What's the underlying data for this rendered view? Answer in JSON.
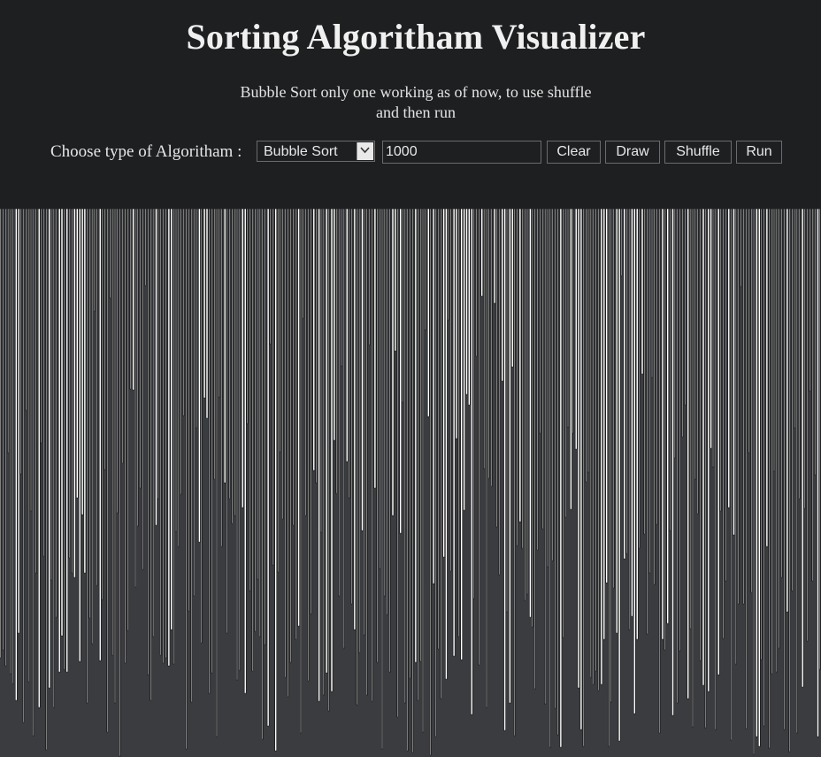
{
  "page": {
    "title": "Sorting Algoritham Visualizer",
    "note": "Bubble Sort only one working as of now, to use shuffle and then run"
  },
  "controls": {
    "algorithm_label": "Choose type of Algoritham :",
    "algorithm_select": {
      "selected": "Bubble Sort",
      "arrow_icon": "chevron-down-icon"
    },
    "count_input": {
      "value": "1000"
    },
    "buttons": {
      "clear": "Clear",
      "draw": "Draw",
      "shuffle": "Shuffle",
      "run": "Run"
    }
  },
  "visualizer": {
    "bar_count": 1000,
    "colors": {
      "background": "#1e1f21",
      "canvas_background": "#3a3c3f",
      "bar_fill": "#ffffff",
      "bar_outline": "#000000"
    }
  }
}
